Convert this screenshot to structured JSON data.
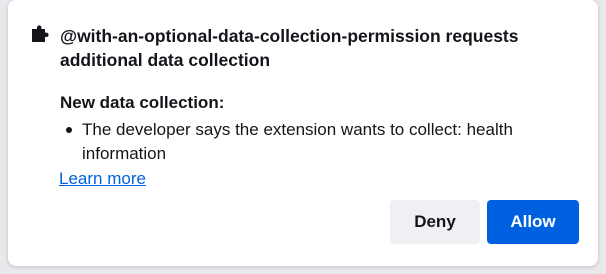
{
  "popup": {
    "icon": "puzzle-piece-icon",
    "heading": "@with-an-optional-data-collection-permission requests additional data collection",
    "section_title": "New data collection:",
    "items": [
      {
        "text": "The developer says the extension wants to collect: health information"
      }
    ],
    "learn_more": "Learn more",
    "deny_label": "Deny",
    "allow_label": "Allow"
  },
  "colors": {
    "accent": "#0061e0",
    "text": "#15141a",
    "secondary_button": "#f0f0f4"
  }
}
